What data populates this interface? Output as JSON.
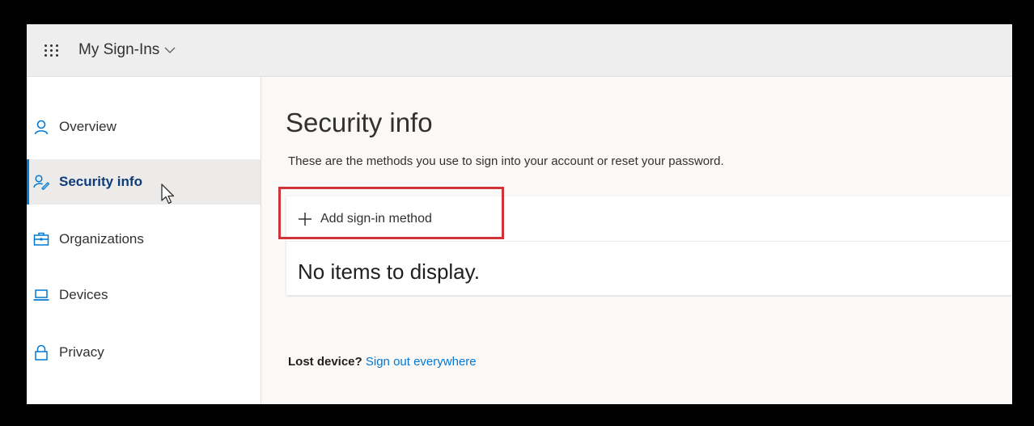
{
  "header": {
    "app_title": "My Sign-Ins"
  },
  "sidebar": {
    "items": [
      {
        "label": "Overview",
        "icon": "person-icon"
      },
      {
        "label": "Security info",
        "icon": "security-info-icon",
        "active": true
      },
      {
        "label": "Organizations",
        "icon": "briefcase-icon"
      },
      {
        "label": "Devices",
        "icon": "laptop-icon"
      },
      {
        "label": "Privacy",
        "icon": "lock-icon"
      }
    ]
  },
  "main": {
    "title": "Security info",
    "subtitle": "These are the methods you use to sign into your account or reset your password.",
    "add_method_label": "Add sign-in method",
    "empty_message": "No items to display.",
    "lost_device_label": "Lost device?",
    "sign_out_link": "Sign out everywhere"
  },
  "colors": {
    "accent": "#0078d4",
    "highlight_box": "#d13438",
    "active_label": "#0f3c78"
  }
}
